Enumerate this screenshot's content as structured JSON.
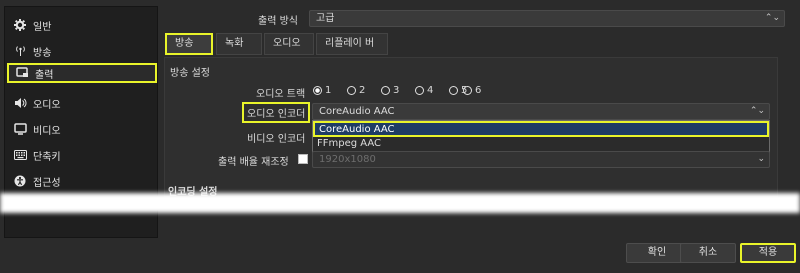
{
  "sidebar": {
    "items": [
      {
        "label": "일반",
        "icon": "gear-icon"
      },
      {
        "label": "방송",
        "icon": "broadcast-icon"
      },
      {
        "label": "출력",
        "icon": "output-icon"
      },
      {
        "label": "오디오",
        "icon": "speaker-icon"
      },
      {
        "label": "비디오",
        "icon": "monitor-icon"
      },
      {
        "label": "단축키",
        "icon": "keyboard-icon"
      },
      {
        "label": "접근성",
        "icon": "accessibility-icon"
      }
    ],
    "active_index": 2
  },
  "output_mode": {
    "label": "출력 방식",
    "value": "고급"
  },
  "tabs": [
    "방송",
    "녹화",
    "오디오",
    "리플레이 버퍼"
  ],
  "active_tab": 0,
  "stream_settings": {
    "title": "방송 설정",
    "audio_track_label": "오디오 트랙",
    "tracks": [
      "1",
      "2",
      "3",
      "4",
      "5",
      "6"
    ],
    "selected_track": "1",
    "audio_encoder_label": "오디오 인코더",
    "audio_encoder_value": "CoreAudio AAC",
    "audio_encoder_options": [
      "CoreAudio AAC",
      "FFmpeg AAC"
    ],
    "video_encoder_label": "비디오 인코더",
    "rescale_label": "출력 배율 재조정",
    "rescale_value": "1920x1080"
  },
  "encoding_settings_title": "인코딩 설정",
  "buttons": {
    "ok": "확인",
    "cancel": "취소",
    "apply": "적용"
  },
  "colors": {
    "highlight": "#e9f42a",
    "selection": "#1f3c64"
  }
}
